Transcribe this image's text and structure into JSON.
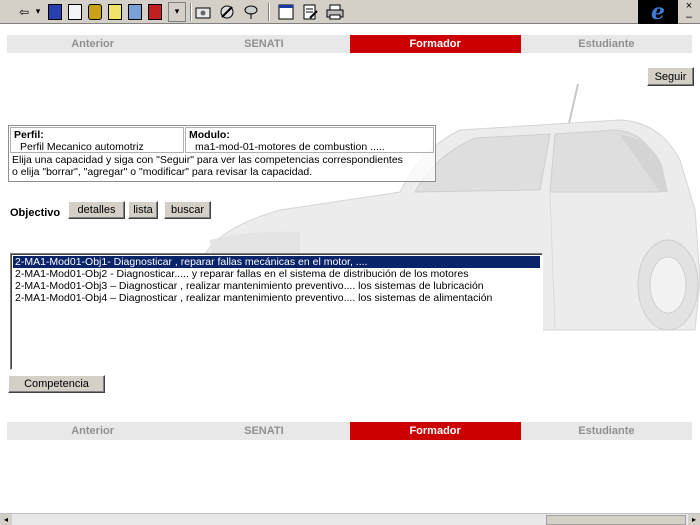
{
  "toolbar": {
    "back_icon": "back-arrow-icon",
    "back_glyph": "⇦",
    "dropdown_glyph": "▾",
    "ie_logo": "e",
    "close_glyph": "×",
    "minimize_glyph": "–"
  },
  "nav_top": {
    "items": [
      {
        "label": "Anterior",
        "active": false
      },
      {
        "label": "SENATI",
        "active": false
      },
      {
        "label": "Formador",
        "active": true
      },
      {
        "label": "Estudiante",
        "active": false
      }
    ]
  },
  "seguir_label": "Seguir",
  "info": {
    "perfil_heading": "Perfil:",
    "perfil_value": "Perfil Mecanico automotriz",
    "modulo_heading": "Modulo:",
    "modulo_value": "ma1-mod-01-motores de combustion .....",
    "instruction_line1": "Elija una capacidad y siga con \"Seguir\" para ver las competencias correspondientes",
    "instruction_line2": "o elija \"borrar\", \"agregar\" o \"modificar\" para revisar la capacidad."
  },
  "objetivo": {
    "label": "Objectivo",
    "detalles_label": "detalles",
    "lista_label": "lista",
    "buscar_label": "buscar"
  },
  "objectives_list": [
    "2-MA1-Mod01-Obj1- Diagnosticar , reparar fallas mecánicas en el motor, ....",
    "2-MA1-Mod01-Obj2 - Diagnosticar..... y reparar fallas en el sistema de distribución de los motores",
    "2-MA1-Mod01-Obj3 – Diagnosticar , realizar mantenimiento preventivo.... los sistemas de lubricación",
    "2-MA1-Mod01-Obj4 – Diagnosticar , realizar mantenimiento preventivo.... los sistemas de alimentación"
  ],
  "competencia_label": "Competencia",
  "nav_bottom": {
    "items": [
      {
        "label": "Anterior",
        "active": false
      },
      {
        "label": "SENATI",
        "active": false
      },
      {
        "label": "Formador",
        "active": true
      },
      {
        "label": "Estudiante",
        "active": false
      }
    ]
  },
  "colors": {
    "nav_active": "#cc0000",
    "nav_inactive": "#e8e8e8",
    "selection": "#0a246a"
  }
}
